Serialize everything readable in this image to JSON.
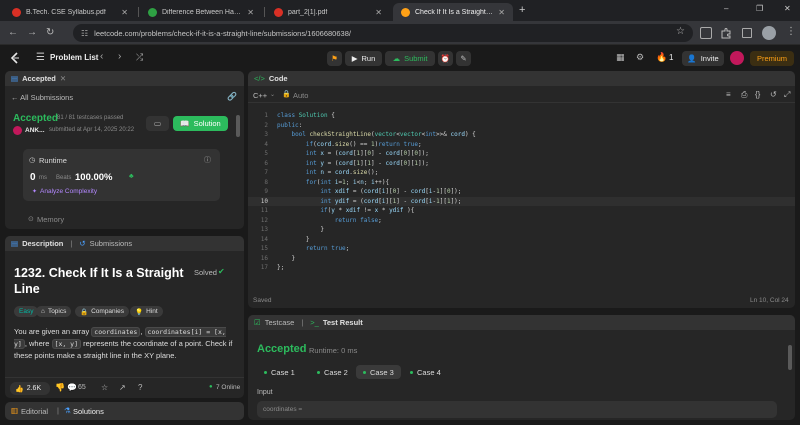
{
  "browser": {
    "tabs": [
      {
        "title": "B.Tech. CSE Syllabus.pdf",
        "icon": "pdf-icon",
        "active": false
      },
      {
        "title": "Difference Between Half Adder",
        "icon": "github-icon",
        "active": false
      },
      {
        "title": "part_2[1].pdf",
        "icon": "pdf-icon",
        "active": false
      },
      {
        "title": "Check If It Is a Straight Line - L",
        "icon": "leetcode-icon",
        "active": true
      }
    ],
    "new_tab": "+",
    "url": "leetcode.com/problems/check-if-it-is-a-straight-line/submissions/1606680638/",
    "window_controls": [
      "–",
      "❐",
      "✕"
    ]
  },
  "lc_nav": {
    "problem_list": "Problem List",
    "run": "Run",
    "submit": "Submit",
    "streak": "1",
    "invite": "Invite",
    "premium": "Premium"
  },
  "submission": {
    "tab_label": "Accepted",
    "all_submissions": "All Submissions",
    "status": "Accepted",
    "testcases": "81 / 81 testcases passed",
    "user": "ANK...",
    "submitted_at": "submitted at Apr 14, 2025 20:22",
    "solution_button": "Solution",
    "runtime_label": "Runtime",
    "runtime_value": "0",
    "runtime_unit": "ms",
    "beats_label": "Beats",
    "beats_value": "100.00%",
    "analyze": "Analyze Complexity",
    "memory_label": "Memory"
  },
  "description": {
    "tab_description": "Description",
    "tab_submissions": "Submissions",
    "title": "1232. Check If It Is a Straight Line",
    "solved": "Solved",
    "tags": [
      "Easy",
      "Topics",
      "Companies",
      "Hint"
    ],
    "text_1": "You are given an array",
    "code_1": "coordinates",
    "text_2": ",",
    "code_2": "coordinates[i] = [x, y]",
    "text_3": ", where",
    "code_3": "[x, y]",
    "text_4": "represents the coordinate of a point. Check if these points make a straight line in the XY plane.",
    "likes": "2.6K",
    "comments": "65",
    "online": "7 Online",
    "tab_editorial": "Editorial",
    "tab_solutions": "Solutions"
  },
  "editor": {
    "tab_label": "Code",
    "language": "C++",
    "auto": "Auto",
    "saved": "Saved",
    "cursor": "Ln 10, Col 24",
    "current_line": 10,
    "lines": [
      "class Solution {",
      "public:",
      "    bool checkStraightLine(vector<vector<int>>& cord) {",
      "        if(cord.size() == 1)return true;",
      "        int x = (cord[1][0] - cord[0][0]);",
      "        int y = (cord[1][1] - cord[0][1]);",
      "        int n = cord.size();",
      "        for(int i=1; i<n; i++){",
      "            int xdif = (cord[i][0] - cord[i-1][0]);",
      "            int ydif = (cord[i][1] - cord[i-1][1]);",
      "            if(y * xdif != x * ydif ){",
      "                return false;",
      "            }",
      "        }",
      "        return true;",
      "    }",
      "};"
    ]
  },
  "testcase": {
    "tab_testcase": "Testcase",
    "tab_result": "Test Result",
    "status": "Accepted",
    "runtime": "Runtime: 0 ms",
    "cases": [
      "Case 1",
      "Case 2",
      "Case 3",
      "Case 4"
    ],
    "active_case": 2,
    "input_label": "Input",
    "input_var": "coordinates ="
  },
  "colors": {
    "accent_green": "#2cbb5d",
    "accent_orange": "#ffa116",
    "panel_bg": "#262626",
    "page_bg": "#1a1a1a"
  }
}
